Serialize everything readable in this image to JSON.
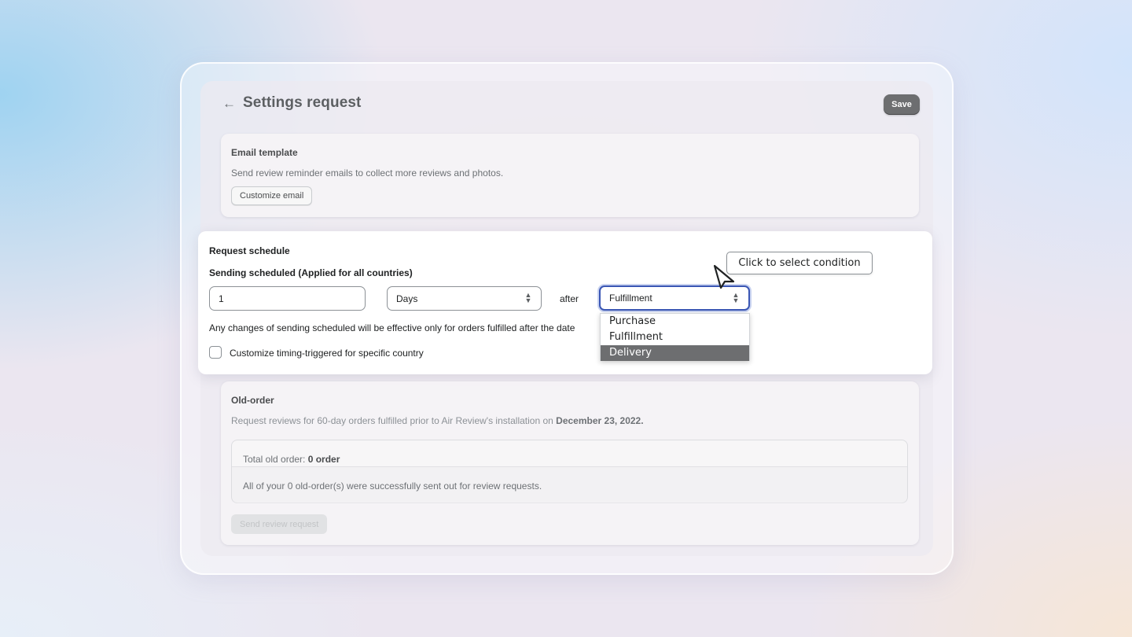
{
  "header": {
    "title": "Settings request",
    "save_label": "Save"
  },
  "email_template": {
    "title": "Email template",
    "description": "Send review reminder emails to collect more reviews and photos.",
    "customize_label": "Customize email"
  },
  "request_schedule": {
    "title": "Request schedule",
    "subtitle": "Sending scheduled (Applied for all countries)",
    "amount_value": "1",
    "unit_value": "Days",
    "after_label": "after",
    "condition_value": "Fulfillment",
    "notice": "Any changes of sending scheduled will be effective only for orders fulfilled after the date",
    "checkbox_label": "Customize timing-triggered for specific country",
    "condition_options": [
      "Purchase",
      "Fulfillment",
      "Delivery"
    ],
    "highlighted_option": "Delivery"
  },
  "tooltip": {
    "text": "Click to select condition"
  },
  "old_order": {
    "title": "Old-order",
    "description_prefix": "Request reviews for 60-day orders fulfilled prior to Air Review's installation on ",
    "install_date": "December 23, 2022.",
    "total_label": "Total old order: ",
    "total_value": "0 order",
    "status_message": "All of your 0 old-order(s) were successfully sent out for review requests.",
    "send_label": "Send review request"
  }
}
